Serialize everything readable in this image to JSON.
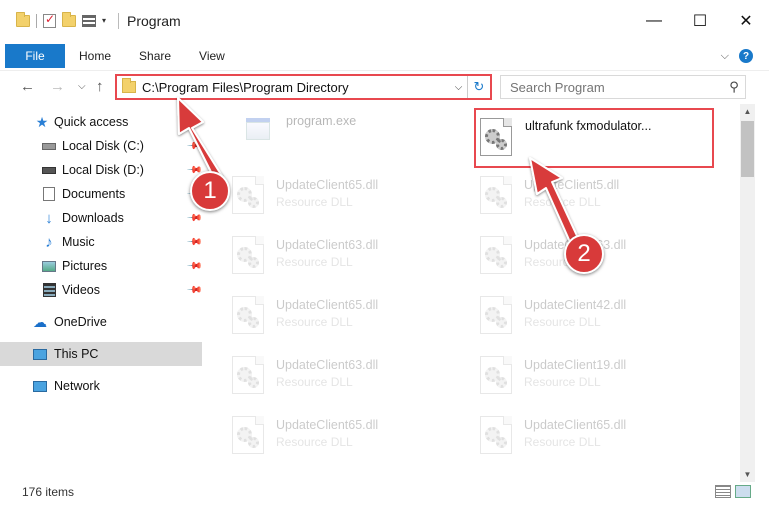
{
  "window": {
    "title": "Program",
    "minimize_glyph": "—",
    "maximize_glyph": "☐",
    "close_glyph": "✕"
  },
  "ribbon": {
    "file": "File",
    "tabs": [
      "Home",
      "Share",
      "View"
    ],
    "help_glyph": "?"
  },
  "address": {
    "path": "C:\\Program Files\\Program Directory",
    "refresh_glyph": "↻"
  },
  "search": {
    "placeholder": "Search Program"
  },
  "sidebar": {
    "items": [
      {
        "label": "Quick access",
        "icon": "star-icon"
      },
      {
        "label": "Local Disk (C:)",
        "icon": "drive-icon"
      },
      {
        "label": "Local Disk (D:)",
        "icon": "drive-icon"
      },
      {
        "label": "Documents",
        "icon": "documents-icon"
      },
      {
        "label": "Downloads",
        "icon": "download-icon"
      },
      {
        "label": "Music",
        "icon": "music-icon"
      },
      {
        "label": "Pictures",
        "icon": "pictures-icon"
      },
      {
        "label": "Videos",
        "icon": "videos-icon"
      },
      {
        "label": "OneDrive",
        "icon": "cloud-icon"
      },
      {
        "label": "This PC",
        "icon": "computer-icon"
      },
      {
        "label": "Network",
        "icon": "network-icon"
      }
    ]
  },
  "files": [
    {
      "name": "program.exe",
      "type": ""
    },
    {
      "name": "ultrafunk fxmodulator...",
      "type": ""
    },
    {
      "name": "UpdateClient65.dll",
      "type": "Resource DLL"
    },
    {
      "name": "UpdateClient5.dll",
      "type": "Resource DLL"
    },
    {
      "name": "UpdateClient63.dll",
      "type": "Resource DLL"
    },
    {
      "name": "UpdateClient63.dll",
      "type": "Resource DLL"
    },
    {
      "name": "UpdateClient65.dll",
      "type": "Resource DLL"
    },
    {
      "name": "UpdateClient42.dll",
      "type": "Resource DLL"
    },
    {
      "name": "UpdateClient63.dll",
      "type": "Resource DLL"
    },
    {
      "name": "UpdateClient19.dll",
      "type": "Resource DLL"
    },
    {
      "name": "UpdateClient65.dll",
      "type": "Resource DLL"
    },
    {
      "name": "UpdateClient65.dll",
      "type": "Resource DLL"
    }
  ],
  "status": {
    "item_count": "176 items"
  },
  "annotations": {
    "step1": "1",
    "step2": "2"
  },
  "colors": {
    "accent": "#1979ca",
    "highlight": "#e8484f",
    "callout": "#d83a3a"
  }
}
